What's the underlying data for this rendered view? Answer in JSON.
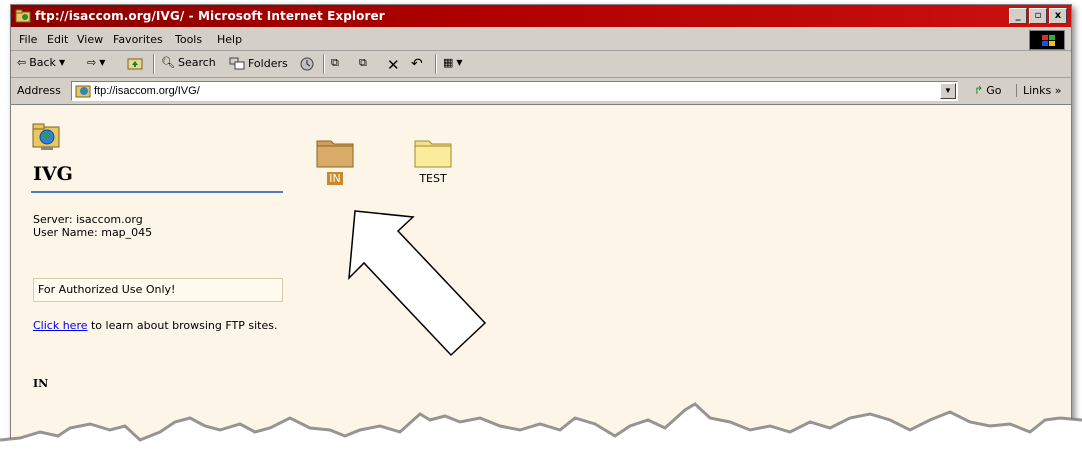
{
  "window": {
    "title": "ftp://isaccom.org/IVG/ - Microsoft Internet Explorer",
    "minimize_label": "_",
    "maximize_label": "▫",
    "close_label": "x"
  },
  "menu": [
    "File",
    "Edit",
    "View",
    "Favorites",
    "Tools",
    "Help"
  ],
  "toolbar": {
    "back_label": "Back",
    "search_label": "Search",
    "folders_label": "Folders"
  },
  "address": {
    "label": "Address",
    "value": "ftp://isaccom.org/IVG/",
    "go_label": "Go",
    "links_label": "Links »"
  },
  "sidebar": {
    "folder_name": "IVG",
    "server_line": "Server: isaccom.org",
    "user_line": "User Name: map_045",
    "notice": "For Authorized Use Only!",
    "help_link": "Click here",
    "help_text": " to learn about browsing FTP sites.",
    "selected_item": "IN"
  },
  "folders": [
    {
      "name": "IN",
      "selected": true
    },
    {
      "name": "TEST",
      "selected": false
    }
  ],
  "colors": {
    "title_bar": "#b00000",
    "content_bg": "#fdf5e8",
    "selection": "#c88a28",
    "rule": "#4d7dc8"
  }
}
